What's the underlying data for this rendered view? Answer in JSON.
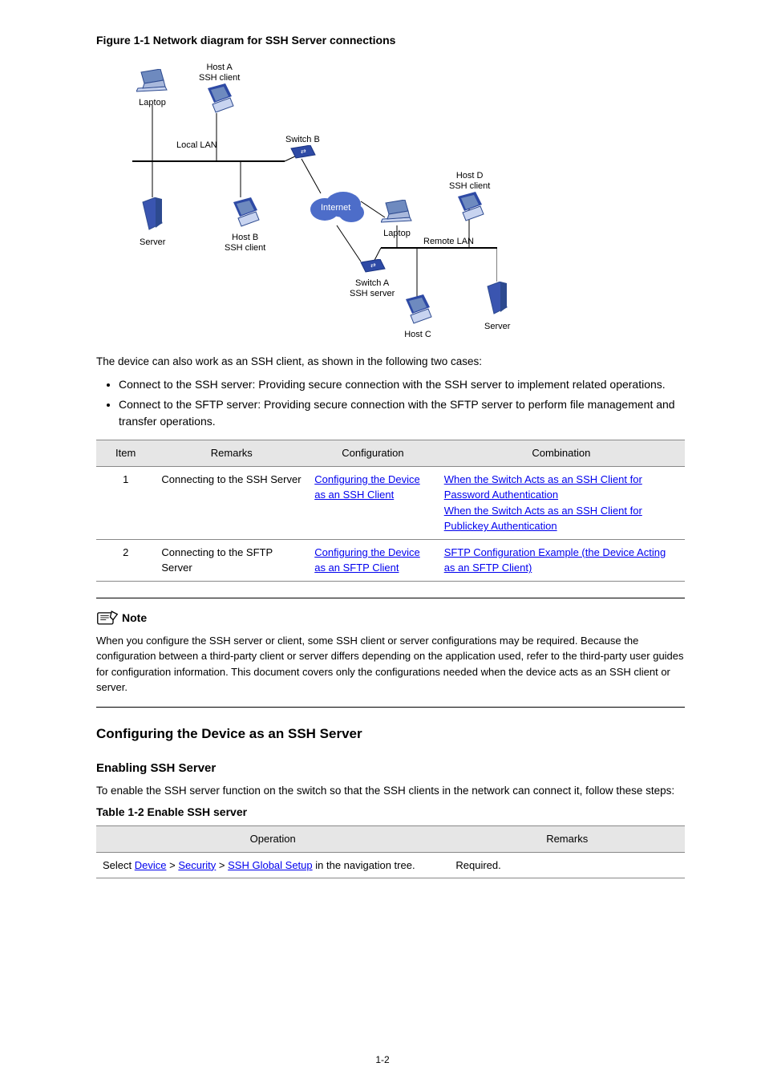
{
  "figure": {
    "caption": "Figure 1-1 Network diagram for SSH Server connections",
    "labels": {
      "laptop1": "Laptop",
      "hostA": "Host A\nSSH client",
      "localLan": "Local LAN",
      "server1": "Server",
      "hostB": "Host B\nSSH client",
      "switchB": "Switch B",
      "internet": "Internet",
      "laptop2": "Laptop",
      "hostD": "Host D\nSSH client",
      "remoteLan": "Remote LAN",
      "switchA": "Switch A\nSSH server",
      "hostC": "Host C",
      "server2": "Server"
    }
  },
  "intro_text": "The device can also work as an SSH client, as shown in the following two cases:",
  "bullets": [
    "Connect to the SSH server: Providing secure connection with the SSH server to implement related operations.",
    "Connect to the SFTP server: Providing secure connection with the SFTP server to perform file management and transfer operations."
  ],
  "table1": {
    "headers": [
      "Item",
      "Remarks",
      "Configuration",
      "Combination"
    ],
    "rows": [
      {
        "idx": "1",
        "remarks": "Connecting to the SSH Server",
        "config_links": [
          "Configuring the Device as an SSH Client"
        ],
        "combo_links": [
          "When the Switch Acts as an SSH Client for Password Authentication",
          "When the Switch Acts as an SSH Client for Publickey Authentication"
        ]
      },
      {
        "idx": "2",
        "remarks": "Connecting to the SFTP Server",
        "config_links": [
          "Configuring the Device as an SFTP Client"
        ],
        "combo_links": [
          "SFTP Configuration Example (the Device Acting as an SFTP Client)"
        ]
      }
    ]
  },
  "note": {
    "heading": "Note",
    "body": "When you configure the SSH server or client, some SSH client or server configurations may be required. Because the configuration between a third-party client or server differs depending on the application used, refer to the third-party user guides for configuration information. This document covers only the configurations needed when the device acts as an SSH client or server."
  },
  "section2": {
    "heading": "Configuring the Device as an SSH Server",
    "subhead": "Enabling SSH Server",
    "para": "To enable the SSH server function on the switch so that the SSH clients in the network can connect it, follow these steps:",
    "table_caption": "Table 1-2 Enable SSH server",
    "table": {
      "headers": [
        "Operation",
        "Remarks"
      ],
      "op_prefix": "Select ",
      "op_links": [
        "Device",
        "Security",
        "SSH Global Setup"
      ],
      "op_suffix": " in the navigation tree.",
      "remarks": "Required."
    }
  },
  "page_num": "1-2"
}
